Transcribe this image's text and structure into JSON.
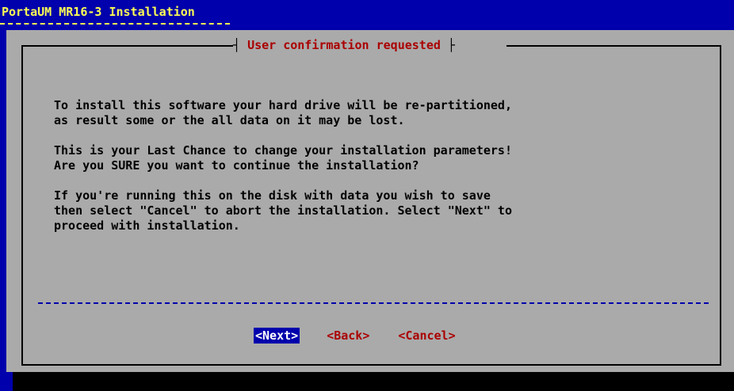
{
  "header": {
    "title": "PortaUM MR16-3 Installation"
  },
  "dialog": {
    "heading": "User confirmation requested",
    "paragraphs": [
      "To install this software your hard drive will be re-partitioned,\nas result some or the all data on it may be lost.",
      "This is your Last Chance to change your installation parameters!\nAre you SURE you want to continue the installation?",
      "If you're running this on the disk with data you wish to save\nthen select \"Cancel\" to abort the installation. Select \"Next\" to\nproceed with installation."
    ],
    "buttons": {
      "next": "<Next>",
      "back": "<Back>",
      "cancel": "<Cancel>"
    },
    "selected_button": "next"
  },
  "colors": {
    "background": "#0000ac",
    "dialog": "#aaaaaa",
    "title_text": "#ffff55",
    "heading_text": "#aa0000",
    "button_text": "#aa0000",
    "selected_button_bg": "#0000ac"
  }
}
